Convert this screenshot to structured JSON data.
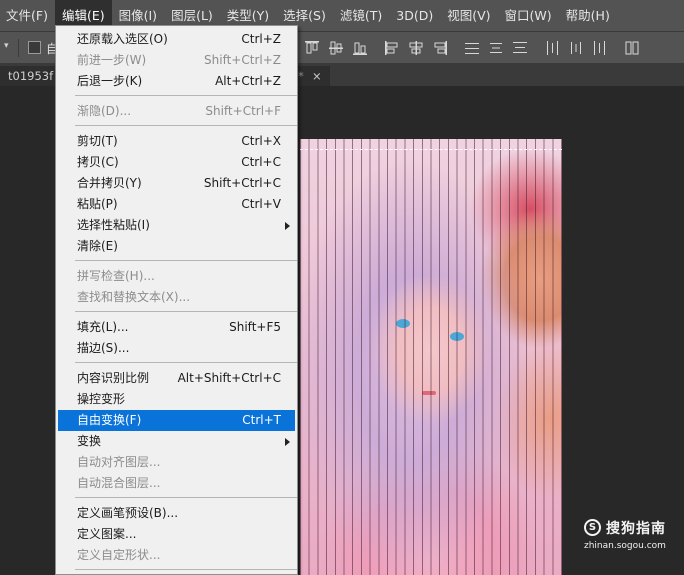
{
  "menubar": {
    "items": [
      {
        "label": "文件(F)"
      },
      {
        "label": "编辑(E)"
      },
      {
        "label": "图像(I)"
      },
      {
        "label": "图层(L)"
      },
      {
        "label": "类型(Y)"
      },
      {
        "label": "选择(S)"
      },
      {
        "label": "滤镜(T)"
      },
      {
        "label": "3D(D)"
      },
      {
        "label": "视图(V)"
      },
      {
        "label": "窗口(W)"
      },
      {
        "label": "帮助(H)"
      }
    ]
  },
  "options_bar": {
    "checkbox_label": "自"
  },
  "document_tab": {
    "title": "t01953f",
    "modified_marker": "*",
    "close": "×"
  },
  "edit_menu": {
    "items": [
      {
        "label": "还原载入选区(O)",
        "shortcut": "Ctrl+Z",
        "disabled": false
      },
      {
        "label": "前进一步(W)",
        "shortcut": "Shift+Ctrl+Z",
        "disabled": true
      },
      {
        "label": "后退一步(K)",
        "shortcut": "Alt+Ctrl+Z",
        "disabled": false
      },
      {
        "label": "渐隐(D)...",
        "shortcut": "Shift+Ctrl+F",
        "disabled": true
      },
      {
        "label": "剪切(T)",
        "shortcut": "Ctrl+X",
        "disabled": false
      },
      {
        "label": "拷贝(C)",
        "shortcut": "Ctrl+C",
        "disabled": false
      },
      {
        "label": "合并拷贝(Y)",
        "shortcut": "Shift+Ctrl+C",
        "disabled": false
      },
      {
        "label": "粘贴(P)",
        "shortcut": "Ctrl+V",
        "disabled": false
      },
      {
        "label": "选择性粘贴(I)",
        "shortcut": "",
        "disabled": false,
        "submenu": true
      },
      {
        "label": "清除(E)",
        "shortcut": "",
        "disabled": false
      },
      {
        "label": "拼写检查(H)...",
        "shortcut": "",
        "disabled": true
      },
      {
        "label": "查找和替换文本(X)...",
        "shortcut": "",
        "disabled": true
      },
      {
        "label": "填充(L)...",
        "shortcut": "Shift+F5",
        "disabled": false
      },
      {
        "label": "描边(S)...",
        "shortcut": "",
        "disabled": false
      },
      {
        "label": "内容识别比例",
        "shortcut": "Alt+Shift+Ctrl+C",
        "disabled": false
      },
      {
        "label": "操控变形",
        "shortcut": "",
        "disabled": false
      },
      {
        "label": "自由变换(F)",
        "shortcut": "Ctrl+T",
        "disabled": false,
        "highlighted": true
      },
      {
        "label": "变换",
        "shortcut": "",
        "disabled": false,
        "submenu": true
      },
      {
        "label": "自动对齐图层...",
        "shortcut": "",
        "disabled": true
      },
      {
        "label": "自动混合图层...",
        "shortcut": "",
        "disabled": true
      },
      {
        "label": "定义画笔预设(B)...",
        "shortcut": "",
        "disabled": false
      },
      {
        "label": "定义图案...",
        "shortcut": "",
        "disabled": false
      },
      {
        "label": "定义自定形状...",
        "shortcut": "",
        "disabled": true
      }
    ]
  },
  "watermark": {
    "logo": "S",
    "name": "搜狗指南",
    "domain": "zhinan.sogou.com"
  },
  "colors": {
    "highlight": "#0a73d9",
    "menubar_bg": "#535353",
    "workspace_bg": "#282828",
    "menu_bg": "#f0f0f0"
  }
}
